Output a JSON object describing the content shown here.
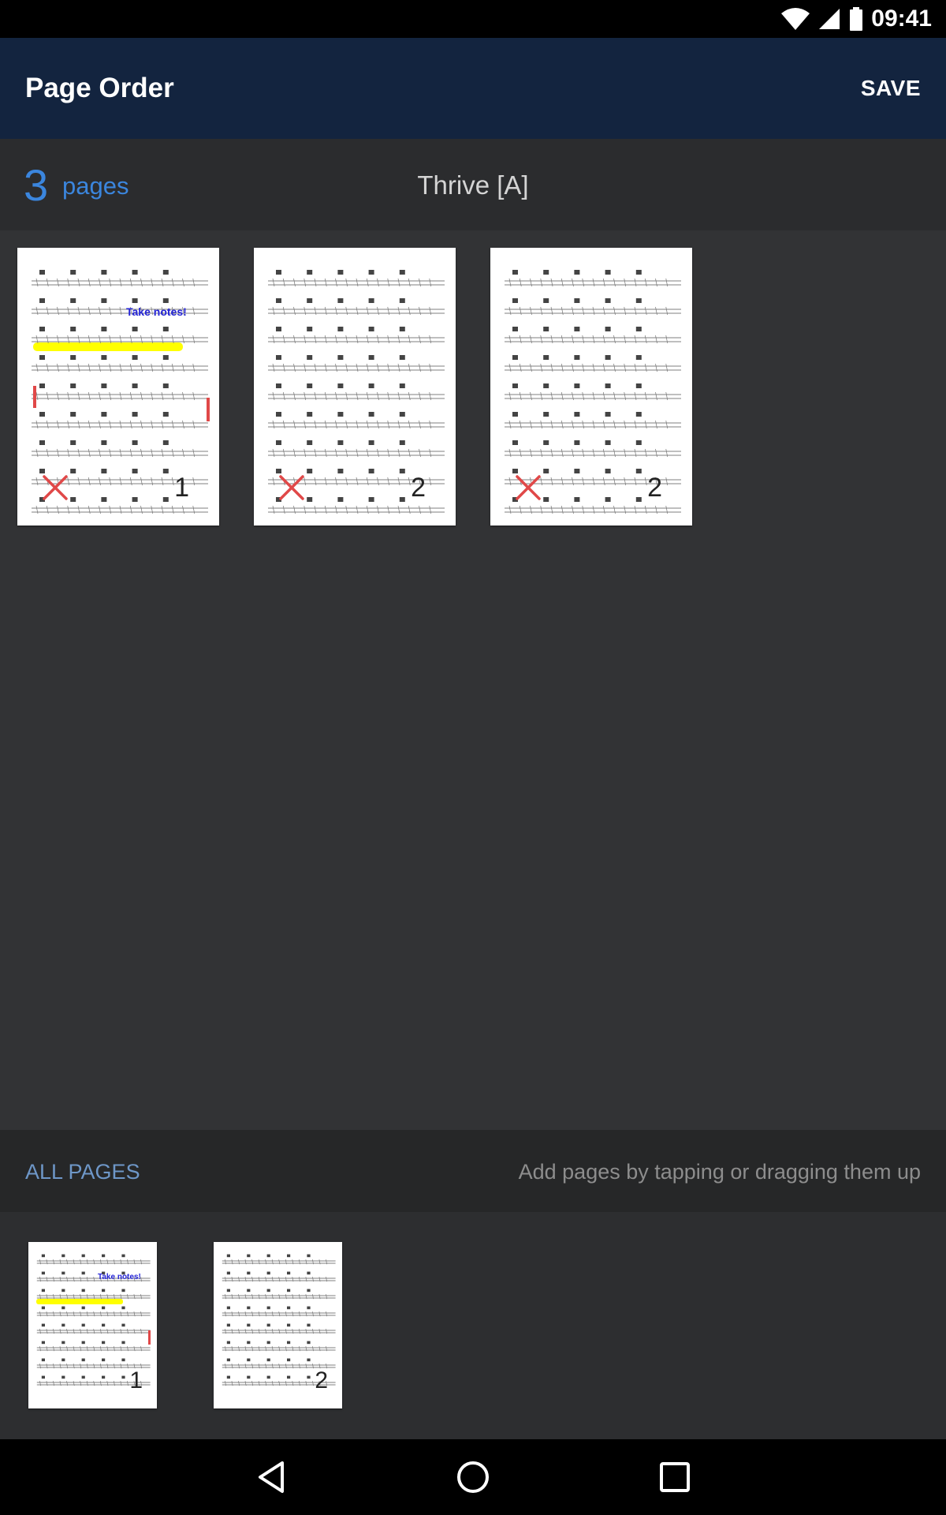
{
  "status_bar": {
    "time": "09:41"
  },
  "app_bar": {
    "title": "Page Order",
    "save_label": "SAVE"
  },
  "info_bar": {
    "page_count": "3",
    "pages_label": "pages",
    "song_title": "Thrive [A]"
  },
  "order_pages": [
    {
      "number": "1",
      "annotation": "Take notes!"
    },
    {
      "number": "2"
    },
    {
      "number": "2"
    }
  ],
  "all_pages_bar": {
    "label": "ALL PAGES",
    "hint": "Add pages by tapping or dragging them up"
  },
  "library_pages": [
    {
      "number": "1",
      "annotation": "Take notes!"
    },
    {
      "number": "2"
    }
  ],
  "colors": {
    "app_bar": "#13243f",
    "accent": "#3b86de",
    "remove": "#e04848",
    "highlight": "#ffff00",
    "annotation": "#2525d8"
  }
}
